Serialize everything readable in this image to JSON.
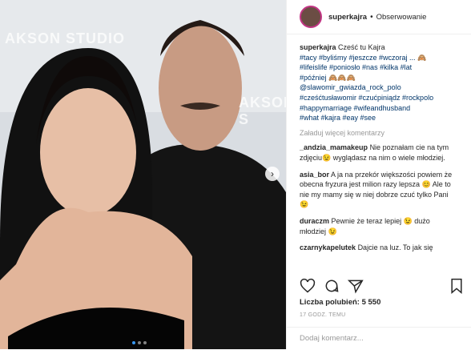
{
  "post": {
    "username": "superkajra",
    "follow_label": "Obserwowanie",
    "separator": "•",
    "caption_user": "superkajra",
    "caption_text": "Cześć tu Kajra",
    "hashtags_line1": "#tacy #byliśmy #jeszcze #wczoraj ... 🙈",
    "hashtags_line2": "#lifeislife #poniosło #nas #kilka #lat",
    "hashtags_line3": "#później 🙈🙈🙈",
    "hashtags_line4": "@slawomir_gwiazda_rock_polo",
    "hashtags_line5": "#cześćtusławomir #czućpiniądz #rockpolo",
    "hashtags_line6": "#happymarriage #wifeandhusband",
    "hashtags_line7": "#what #kajra #eay #see",
    "load_more": "Załaduj więcej komentarzy",
    "comments": [
      {
        "user": "_andzia_mamakeup",
        "text": "Nie poznałam cie na tym zdjęciu😉 wyglądasz na nim o wiele młodziej."
      },
      {
        "user": "asia_bor",
        "text": "A ja na przekór większości powiem że obecna fryzura jest milion razy lepsza 😊 Ale to nie my mamy się w niej dobrze czuć tylko Pani 😉"
      },
      {
        "user": "duraczm",
        "text": "Pewnie że teraz lepiej 😉 dużo młodziej 😉"
      },
      {
        "user": "czarnykapelutek",
        "text": "Dajcie na luz. To jak się"
      }
    ],
    "likes": "Liczba polubień: 5 550",
    "time": "17 GODZ. TEMU",
    "add_comment_placeholder": "Dodaj komentarz...",
    "photo_text_left": "AKSON STUDIO",
    "photo_text_right": "AKSON S",
    "next_icon": "chevron-right-icon"
  }
}
